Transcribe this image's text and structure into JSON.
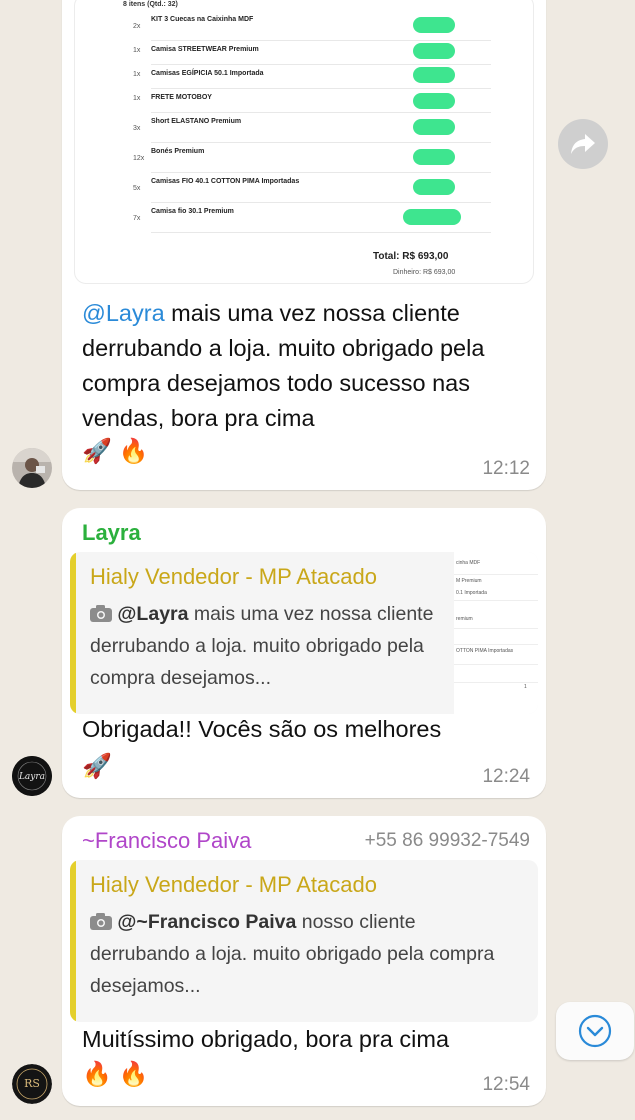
{
  "colors": {
    "background": "#efeae2",
    "mention": "#2a8ad8",
    "sender_layra": "#2bb03d",
    "sender_francisco": "#b046c9",
    "quote_author": "#c9a719",
    "quote_bar": "#e4cf2c"
  },
  "message1": {
    "receipt": {
      "header": "8 itens (Qtd.: 32)",
      "items": [
        {
          "qty": "2x",
          "name": "KIT 3 Cuecas na Caixinha MDF"
        },
        {
          "qty": "1x",
          "name": "Camisa STREETWEAR Premium"
        },
        {
          "qty": "1x",
          "name": "Camisas EGÍPICIA 50.1 Importada"
        },
        {
          "qty": "1x",
          "name": "FRETE MOTOBOY"
        },
        {
          "qty": "3x",
          "name": "Short ELASTANO Premium"
        },
        {
          "qty": "12x",
          "name": "Bonés Premium"
        },
        {
          "qty": "5x",
          "name": "Camisas FIO 40.1 COTTON PIMA Importadas"
        },
        {
          "qty": "7x",
          "name": "Camisa fio 30.1 Premium"
        }
      ],
      "total": "Total: R$ 693,00",
      "cash": "Dinheiro: R$ 693,00"
    },
    "caption_mention": "@Layra",
    "caption_text": " mais uma vez nossa cliente derrubando a loja. muito obrigado pela compra desejamos todo sucesso nas vendas, bora pra cima",
    "caption_emoji": "🚀 🔥",
    "time": "12:12"
  },
  "message2": {
    "sender": "Layra",
    "quote_author": "Hialy Vendedor - MP Atacado",
    "quote_icon": "camera-icon",
    "quote_mention": "@Layra",
    "quote_text": " mais uma vez nossa cliente derrubando a loja. muito obrigado pela compra desejamos...",
    "text": "Obrigada!! Vocês são os melhores",
    "emoji": "🚀",
    "time": "12:24"
  },
  "message3": {
    "sender": "~Francisco Paiva",
    "phone": "+55 86 99932-7549",
    "quote_author": "Hialy Vendedor - MP Atacado",
    "quote_icon": "camera-icon",
    "quote_mention": "@~Francisco Paiva",
    "quote_text": " nosso cliente derrubando a loja. muito obrigado pela compra desejamos...",
    "text": "Muitíssimo obrigado,  bora pra cima",
    "emoji": "🔥 🔥",
    "time": "12:54"
  },
  "avatars": {
    "layra_logo": "Layra",
    "rs_logo": "RS"
  },
  "thumb_lines": [
    "cinha MDF",
    "M Premium",
    "0.1 Importada",
    "remium",
    "OTTON PIMA Importadas",
    "1"
  ]
}
